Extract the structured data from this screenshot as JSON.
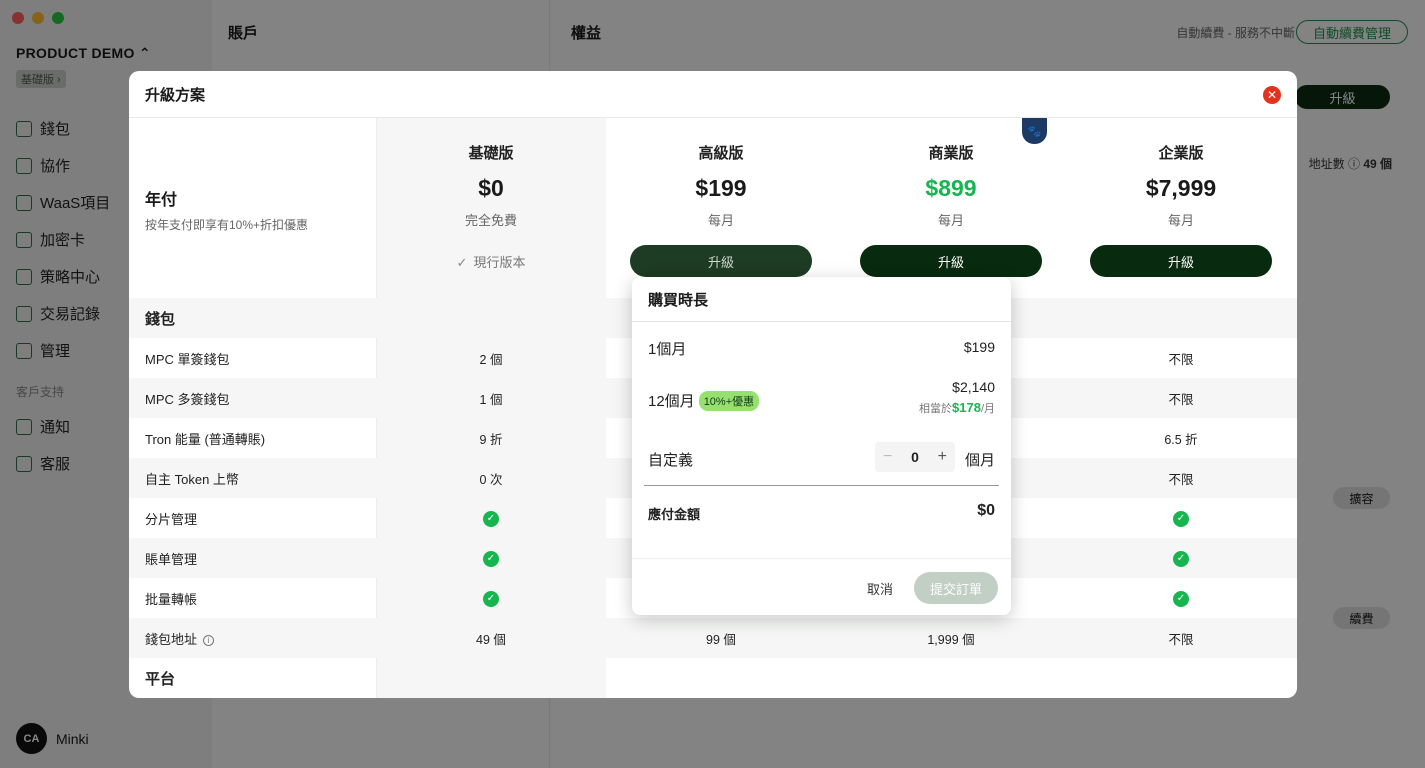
{
  "sidebar": {
    "product": "PRODUCT DEMO ⌃",
    "plan_badge": "基礎版 ›",
    "items": [
      {
        "label": "錢包"
      },
      {
        "label": "協作"
      },
      {
        "label": "WaaS項目"
      },
      {
        "label": "加密卡"
      },
      {
        "label": "策略中心"
      },
      {
        "label": "交易記錄"
      },
      {
        "label": "管理"
      }
    ],
    "support_title": "客戶支持",
    "support_items": [
      {
        "label": "通知"
      },
      {
        "label": "客服"
      }
    ],
    "user": {
      "avatar_text": "CA",
      "name": "Minki"
    }
  },
  "accounts": {
    "title": "賬戶"
  },
  "benefits": {
    "title": "權益",
    "renew_text": "自動續費 - 服務不中斷",
    "renew_button": "自動續費管理",
    "upgrade_button": "升級",
    "address_count_label": "地址數",
    "address_count_value": "49 個",
    "expand_button": "擴容",
    "renew_pill": "續費"
  },
  "modal": {
    "title": "升級方案",
    "close_icon": "✕",
    "annual_title": "年付",
    "annual_sub": "按年支付即享有10%+折扣優惠",
    "plans": [
      {
        "name": "基礎版",
        "price": "$0",
        "period": "完全免費",
        "current_label": "現行版本"
      },
      {
        "name": "高級版",
        "price": "$199",
        "period": "每月",
        "button": "升級"
      },
      {
        "name": "商業版",
        "price": "$899",
        "period": "每月",
        "button": "升級"
      },
      {
        "name": "企業版",
        "price": "$7,999",
        "period": "每月",
        "button": "升級"
      }
    ],
    "sections": {
      "wallet": "錢包",
      "platform": "平台"
    },
    "features": [
      {
        "label": "MPC 單簽錢包",
        "basic": "2 個",
        "enterprise": "不限"
      },
      {
        "label": "MPC 多簽錢包",
        "basic": "1 個",
        "enterprise": "不限"
      },
      {
        "label": "Tron 能量 (普通轉賬)",
        "basic": "9 折",
        "enterprise": "6.5 折"
      },
      {
        "label": "自主 Token 上幣",
        "basic": "0 次",
        "enterprise": "不限"
      },
      {
        "label": "分片管理",
        "basic": "✓",
        "enterprise": "✓"
      },
      {
        "label": "賬单管理",
        "basic": "✓",
        "enterprise": "✓"
      },
      {
        "label": "批量轉帳",
        "basic": "✓",
        "enterprise": "✓"
      },
      {
        "label": "錢包地址",
        "basic": "49 個",
        "premium": "99 個",
        "business": "1,999 個",
        "enterprise": "不限"
      }
    ]
  },
  "popover": {
    "title": "購買時長",
    "option1_label": "1個月",
    "option1_price": "$199",
    "option2_label": "12個月",
    "option2_badge": "10%+優惠",
    "option2_price": "$2,140",
    "option2_equiv_prefix": "相當於",
    "option2_equiv_value": "$178",
    "option2_equiv_suffix": "/月",
    "custom_label": "自定義",
    "stepper_value": "0",
    "stepper_unit": "個月",
    "total_label": "應付金額",
    "total_value": "$0",
    "cancel": "取消",
    "submit": "提交訂單"
  },
  "colors": {
    "accent_green": "#17b54f",
    "dark_button": "#082a0e",
    "close_red": "#e5321e"
  }
}
